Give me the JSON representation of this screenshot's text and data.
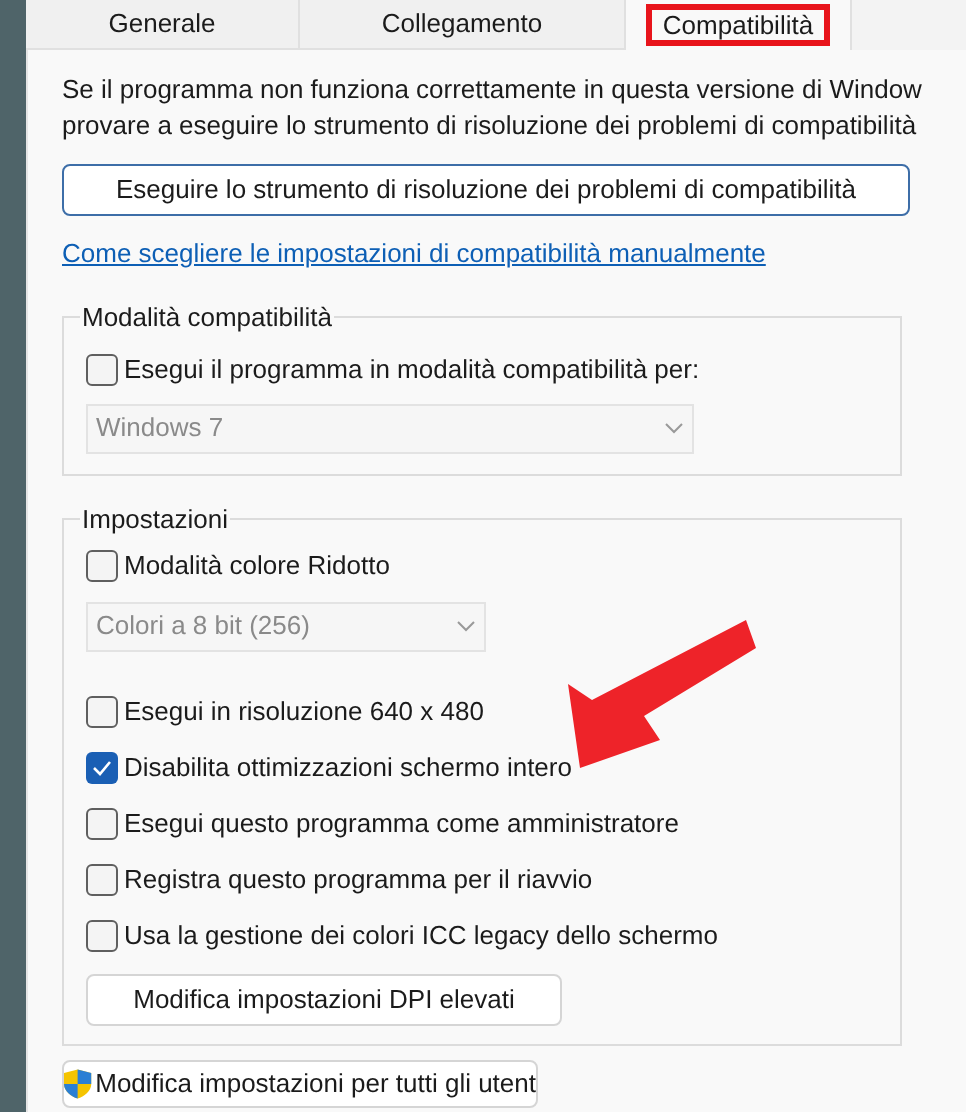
{
  "tabs": [
    {
      "label": "Generale",
      "selected": false
    },
    {
      "label": "Collegamento",
      "selected": false
    },
    {
      "label": "Compatibilità",
      "selected": true
    }
  ],
  "intro_lines": [
    "Se il programma non funziona correttamente in questa versione di Window",
    "provare a eseguire lo strumento di risoluzione dei problemi di compatibilità"
  ],
  "troubleshoot_button": "Eseguire lo strumento di risoluzione dei problemi di compatibilità",
  "manual_link": "Come scegliere le impostazioni di compatibilità manualmente",
  "compat_group": {
    "title": "Modalità compatibilità",
    "checkbox": {
      "label": "Esegui il programma in modalità compatibilità per:",
      "checked": false
    },
    "dropdown": {
      "value": "Windows 7",
      "disabled": true
    }
  },
  "settings_group": {
    "title": "Impostazioni",
    "items": [
      {
        "kind": "checkbox",
        "label": "Modalità colore Ridotto",
        "checked": false
      },
      {
        "kind": "dropdown",
        "value": "Colori a 8 bit (256)",
        "disabled": true
      },
      {
        "kind": "checkbox",
        "label": "Esegui in risoluzione 640 x 480",
        "checked": false
      },
      {
        "kind": "checkbox",
        "label": "Disabilita ottimizzazioni schermo intero",
        "checked": true
      },
      {
        "kind": "checkbox",
        "label": "Esegui questo programma come amministratore",
        "checked": false
      },
      {
        "kind": "checkbox",
        "label": "Registra questo programma per il riavvio",
        "checked": false
      },
      {
        "kind": "checkbox",
        "label": "Usa la gestione dei colori ICC legacy dello schermo",
        "checked": false
      },
      {
        "kind": "button",
        "label": "Modifica impostazioni DPI elevati"
      }
    ]
  },
  "all_users_button": "Modifica impostazioni per tutti gli utent"
}
